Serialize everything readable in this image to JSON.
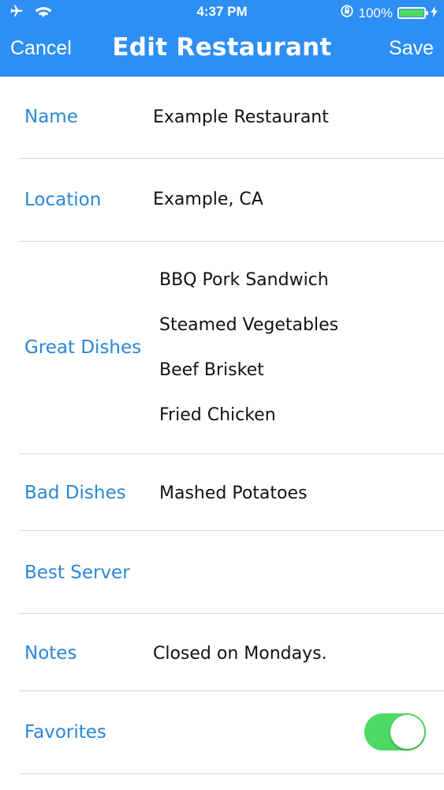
{
  "status_bar": {
    "time": "4:37 PM",
    "battery_percent": "100%",
    "battery_level": 1.0
  },
  "nav": {
    "cancel_label": "Cancel",
    "title": "Edit Restaurant",
    "save_label": "Save"
  },
  "fields": {
    "name": {
      "label": "Name",
      "value": "Example Restaurant"
    },
    "location": {
      "label": "Location",
      "value": "Example, CA"
    },
    "great_dishes": {
      "label": "Great Dishes",
      "items": [
        "BBQ Pork Sandwich",
        "Steamed Vegetables",
        "Beef Brisket",
        "Fried Chicken"
      ]
    },
    "bad_dishes": {
      "label": "Bad Dishes",
      "items": [
        "Mashed Potatoes"
      ]
    },
    "best_server": {
      "label": "Best Server",
      "value": ""
    },
    "notes": {
      "label": "Notes",
      "value": "Closed on Mondays."
    },
    "favorites": {
      "label": "Favorites",
      "on": true
    }
  },
  "colors": {
    "nav_bar": "#2d8ef3",
    "label": "#2a86d6",
    "toggle_on": "#4cd964"
  }
}
